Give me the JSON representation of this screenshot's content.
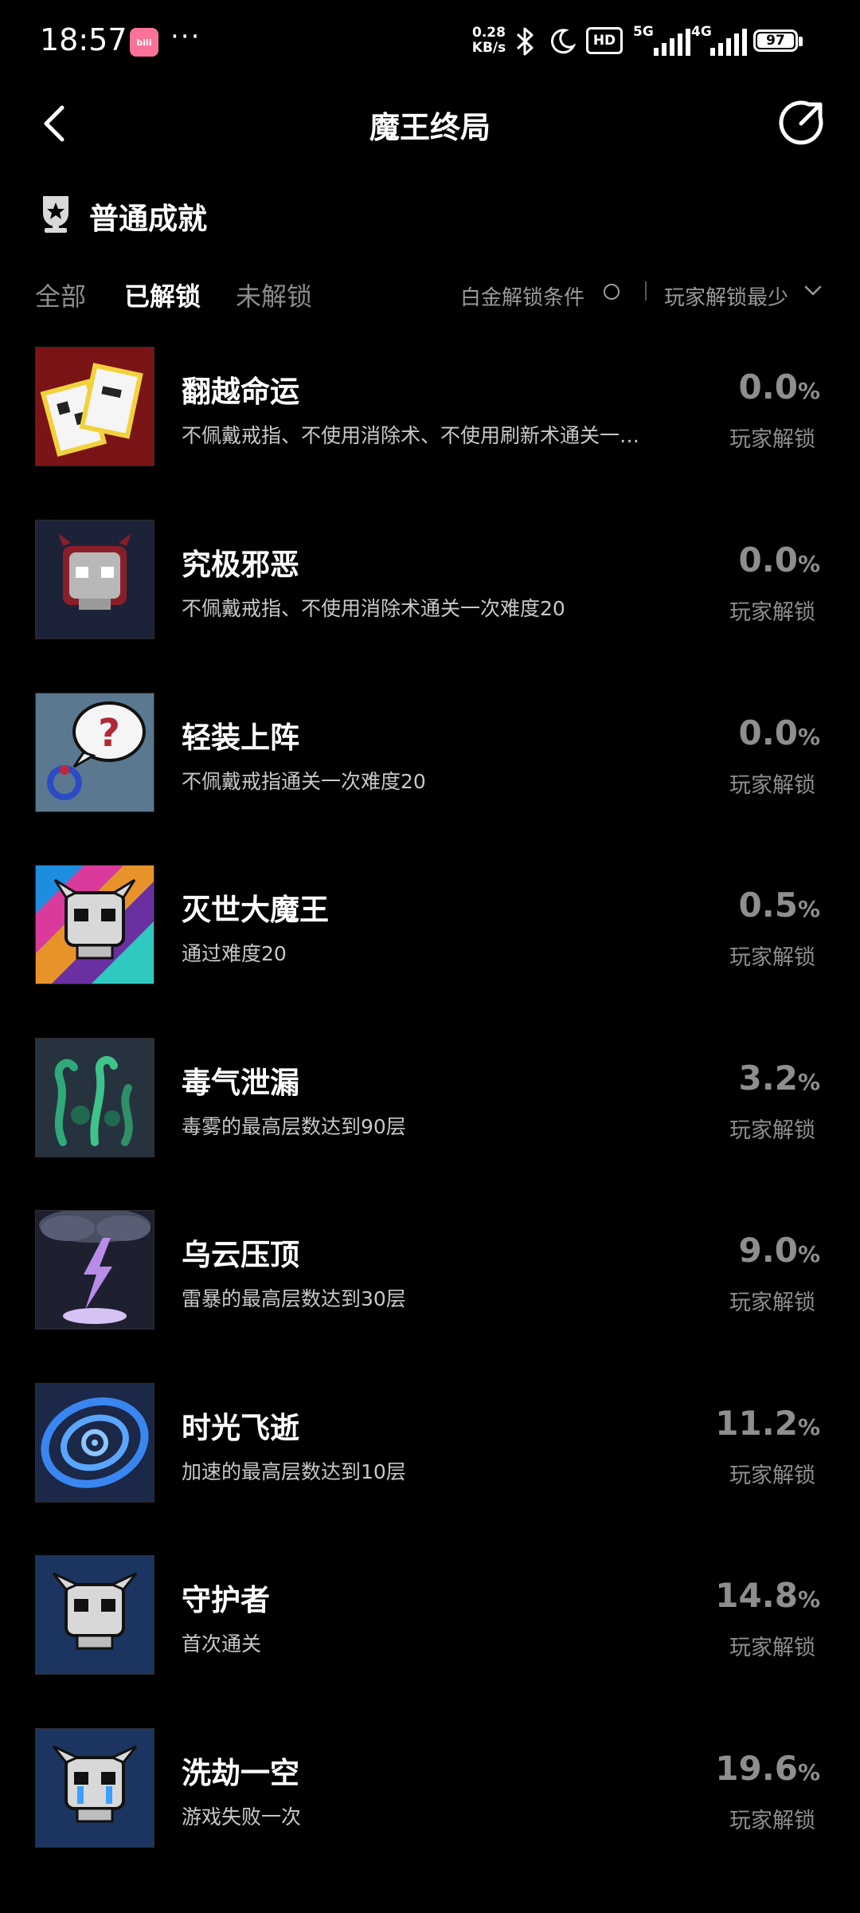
{
  "status_bar": {
    "time": "18:57",
    "app_badge": "bili",
    "dots": "···",
    "net_speed_value": "0.28",
    "net_speed_unit": "KB/s",
    "hd_label": "HD",
    "net_5g": "5G",
    "net_4g": "4G",
    "battery": "97",
    "icons": [
      "bluetooth-icon",
      "moon-icon",
      "hd-icon",
      "signal-5g-icon",
      "signal-4g-icon",
      "battery-icon"
    ]
  },
  "nav": {
    "title": "魔王终局",
    "back_icon": "back-icon",
    "share_icon": "share-icon"
  },
  "section": {
    "title": "普通成就",
    "icon": "trophy-icon"
  },
  "filters": {
    "tabs": [
      {
        "label": "全部",
        "active": false
      },
      {
        "label": "已解锁",
        "active": true
      },
      {
        "label": "未解锁",
        "active": false
      }
    ],
    "condition_label": "白金解锁条件",
    "sort_label": "玩家解锁最少"
  },
  "achievements": [
    {
      "name": "翻越命运",
      "desc": "不佩戴戒指、不使用消除术、不使用刷新术通关一…",
      "pct": "0.0",
      "unit": "%",
      "sub": "玩家解锁",
      "icon": "cards-icon"
    },
    {
      "name": "究极邪恶",
      "desc": "不佩戴戒指、不使用消除术通关一次难度20",
      "pct": "0.0",
      "unit": "%",
      "sub": "玩家解锁",
      "icon": "evil-skull-icon"
    },
    {
      "name": "轻装上阵",
      "desc": "不佩戴戒指通关一次难度20",
      "pct": "0.0",
      "unit": "%",
      "sub": "玩家解锁",
      "icon": "question-ring-icon"
    },
    {
      "name": "灭世大魔王",
      "desc": "通过难度20",
      "pct": "0.5",
      "unit": "%",
      "sub": "玩家解锁",
      "icon": "demon-king-icon"
    },
    {
      "name": "毒气泄漏",
      "desc": "毒雾的最高层数达到90层",
      "pct": "3.2",
      "unit": "%",
      "sub": "玩家解锁",
      "icon": "poison-gas-icon"
    },
    {
      "name": "乌云压顶",
      "desc": "雷暴的最高层数达到30层",
      "pct": "9.0",
      "unit": "%",
      "sub": "玩家解锁",
      "icon": "thunder-cloud-icon"
    },
    {
      "name": "时光飞逝",
      "desc": "加速的最高层数达到10层",
      "pct": "11.2",
      "unit": "%",
      "sub": "玩家解锁",
      "icon": "time-vortex-icon"
    },
    {
      "name": "守护者",
      "desc": "首次通关",
      "pct": "14.8",
      "unit": "%",
      "sub": "玩家解锁",
      "icon": "guardian-skull-icon"
    },
    {
      "name": "洗劫一空",
      "desc": "游戏失败一次",
      "pct": "19.6",
      "unit": "%",
      "sub": "玩家解锁",
      "icon": "crying-skull-icon"
    }
  ],
  "colors": {
    "background": "#000000",
    "muted_text": "#8e8e8e",
    "app_badge": "#fb7299"
  }
}
